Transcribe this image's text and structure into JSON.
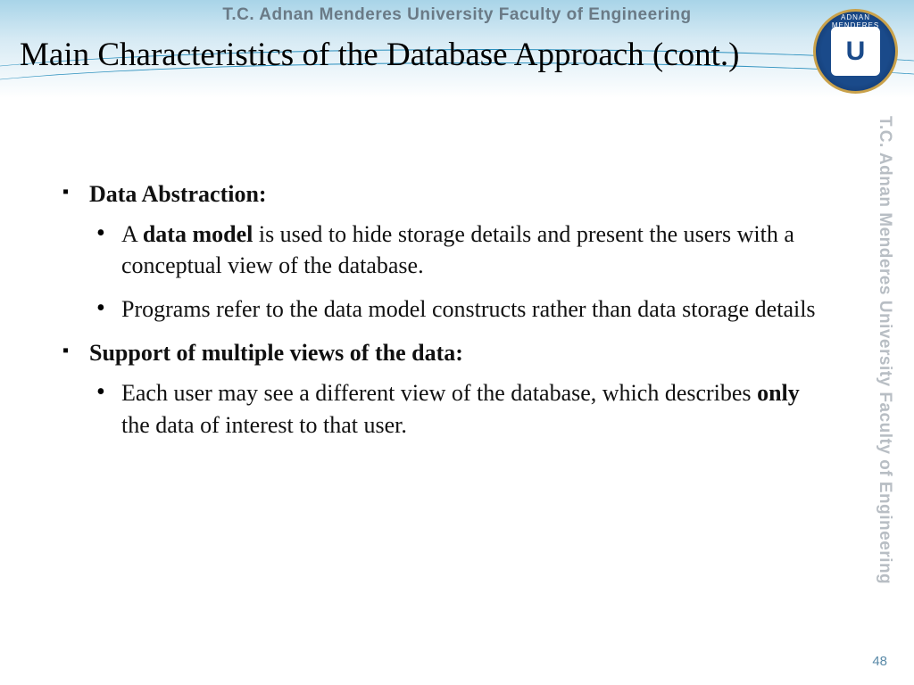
{
  "header": {
    "institution_line": "T.C.    Adnan Menderes University    Faculty of Engineering",
    "logo_letter": "U",
    "logo_ring": "ADNAN MENDERES"
  },
  "side": {
    "institution_line": "T.C.    Adnan Menderes University    Faculty of Engineering"
  },
  "title": "Main Characteristics of the Database Approach (cont.)",
  "bullets": {
    "item1": {
      "heading": "Data Abstraction:",
      "sub1_a": "A ",
      "sub1_b_bold": "data model",
      "sub1_c": " is used to hide storage details and present the users with a conceptual view  of the database.",
      "sub2": "Programs refer to the data model constructs rather than data storage details"
    },
    "item2": {
      "heading": "Support of multiple views of the data:",
      "sub1_a": "Each user may see a different view of the database, which describes ",
      "sub1_b_bold": "only",
      "sub1_c": " the data of interest to that user."
    }
  },
  "page_number": "48"
}
